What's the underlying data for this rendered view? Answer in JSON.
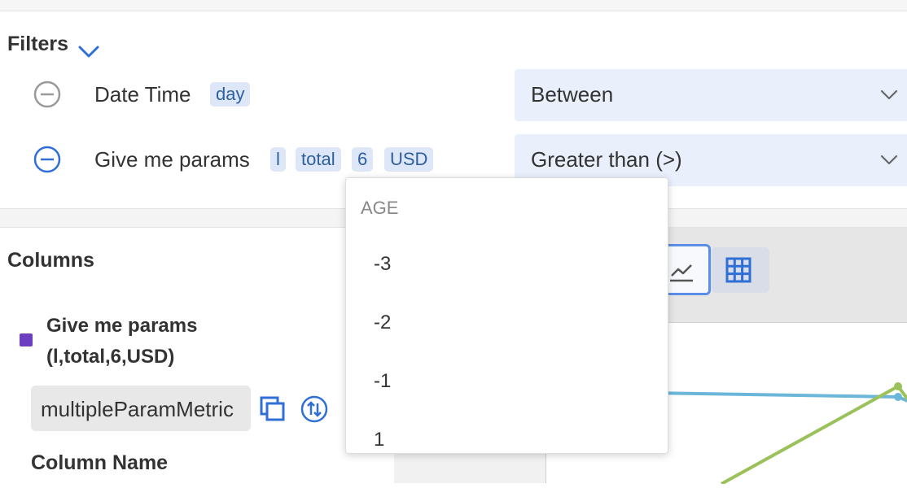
{
  "filters": {
    "title": "Filters",
    "rows": [
      {
        "label": "Date Time",
        "tags": [
          "day"
        ],
        "operator": "Between"
      },
      {
        "label": "Give me params",
        "tags": [
          "l",
          "total",
          "6",
          "USD"
        ],
        "operator": "Greater than (>)"
      }
    ]
  },
  "columns": {
    "title": "Columns",
    "metric": {
      "name_line1": "Give me params",
      "name_line2": "(l,total,6,USD)",
      "field_value": "multipleParamMetric",
      "swatch_color": "#6b3fbf"
    },
    "column_name_label": "Column Name"
  },
  "dropdown": {
    "header": "AGE",
    "items": [
      "-3",
      "-2",
      "-1",
      "1"
    ]
  },
  "colors": {
    "accent": "#2f6fd6",
    "tag_bg": "#dde7f8",
    "select_bg": "#e9f0fc",
    "line_blue": "#6bb6d9",
    "line_green": "#9bc25a"
  },
  "view_toggle": {
    "active": "line-chart",
    "options": [
      "line-chart-icon",
      "table-grid-icon"
    ]
  }
}
